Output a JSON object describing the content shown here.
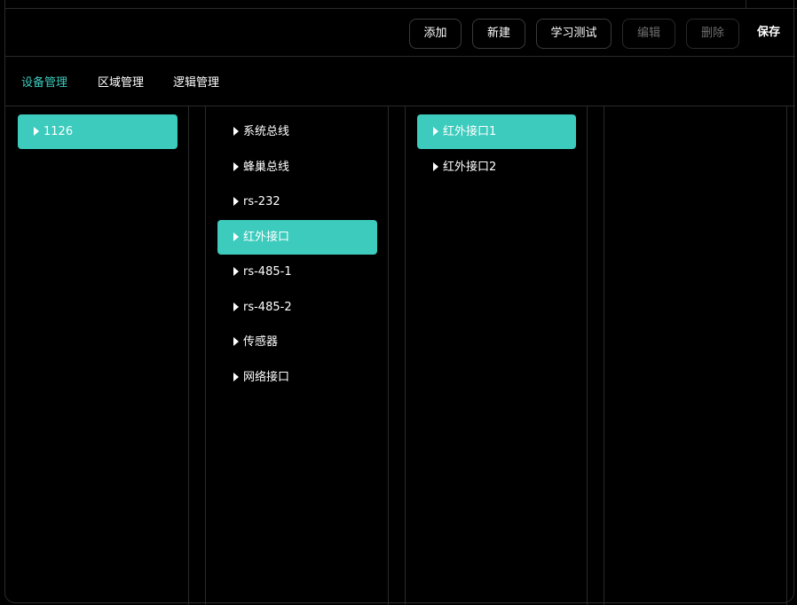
{
  "toolbar": {
    "add_label": "添加",
    "new_label": "新建",
    "learn_test_label": "学习测试",
    "edit_label": "编辑",
    "delete_label": "删除",
    "save_label": "保存"
  },
  "tabs": [
    {
      "label": "设备管理",
      "active": true
    },
    {
      "label": "区域管理",
      "active": false
    },
    {
      "label": "逻辑管理",
      "active": false
    }
  ],
  "devices": {
    "items": [
      {
        "label": "1126",
        "selected": true
      }
    ]
  },
  "buses": {
    "items": [
      {
        "label": "系统总线",
        "selected": false
      },
      {
        "label": "蜂巢总线",
        "selected": false
      },
      {
        "label": "rs-232",
        "selected": false
      },
      {
        "label": "红外接口",
        "selected": true
      },
      {
        "label": "rs-485-1",
        "selected": false
      },
      {
        "label": "rs-485-2",
        "selected": false
      },
      {
        "label": "传感器",
        "selected": false
      },
      {
        "label": "网络接口",
        "selected": false
      }
    ]
  },
  "interfaces": {
    "items": [
      {
        "label": "红外接口1",
        "selected": true
      },
      {
        "label": "红外接口2",
        "selected": false
      }
    ]
  },
  "colors": {
    "accent": "#3ccbbd",
    "background": "#000000",
    "border": "#2a2a2a",
    "disabled_text": "#6e6e6e"
  },
  "icons": {
    "tree_item": "caret-right-icon"
  }
}
